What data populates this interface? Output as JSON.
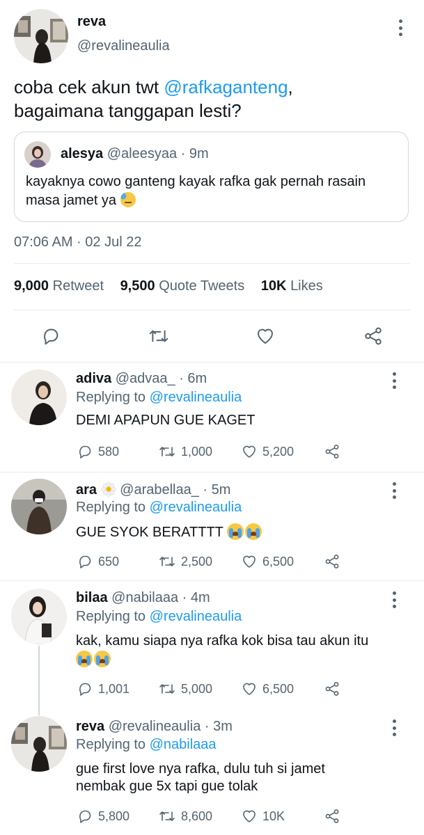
{
  "main_tweet": {
    "name": "reva",
    "handle": "@revalineaulia",
    "text_part1": "coba cek akun twt ",
    "mention": "@rafkaganteng",
    "text_part2": ",",
    "text_line2": "bagaimana tanggapan lesti?",
    "quote": {
      "name": "alesya",
      "handle": "@aleesyaa",
      "time": "9m",
      "text_line1": "kayaknya cowo ganteng kayak rafka gak pernah rasain",
      "text_line2": "masa jamet ya"
    },
    "timestamp": "07:06 AM · 02 Jul 22",
    "stats": {
      "retweets": "9,000",
      "retweets_label": "Retweet",
      "quotes": "9,500",
      "quotes_label": "Quote Tweets",
      "likes": "10K",
      "likes_label": "Likes"
    }
  },
  "replies": [
    {
      "name": "adiva",
      "handle": "@advaa_",
      "time": "6m",
      "replying_label": "Replying to",
      "replying_to": "@revalineaulia",
      "text": "DEMI APAPUN GUE KAGET",
      "replies": "580",
      "retweets": "1,000",
      "likes": "5,200"
    },
    {
      "name": "ara",
      "handle": "@arabellaa_",
      "time": "5m",
      "replying_label": "Replying to",
      "replying_to": "@revalineaulia",
      "text": "GUE SYOK BERATTTT",
      "replies": "650",
      "retweets": "2,500",
      "likes": "6,500"
    },
    {
      "name": "bilaa",
      "handle": "@nabilaaa",
      "time": "4m",
      "replying_label": "Replying to",
      "replying_to": "@revalineaulia",
      "text": "kak, kamu siapa nya rafka kok bisa tau akun itu",
      "replies": "1,001",
      "retweets": "5,000",
      "likes": "6,500"
    },
    {
      "name": "reva",
      "handle": "@revalineaulia",
      "time": "3m",
      "replying_label": "Replying to",
      "replying_to": "@nabilaaa",
      "text_line1": "gue first love nya rafka, dulu tuh si jamet",
      "text_line2": "nembak gue 5x tapi gue tolak",
      "replies": "5,800",
      "retweets": "8,600",
      "likes": "10K"
    }
  ],
  "icons": {
    "reply": "reply-icon",
    "retweet": "retweet-icon",
    "like": "heart-icon",
    "share": "share-icon",
    "more": "more-vertical-icon"
  },
  "colors": {
    "link": "#1d9bf0",
    "secondary_text": "#536471",
    "primary_text": "#0f1419",
    "divider": "#e6ecf0"
  }
}
